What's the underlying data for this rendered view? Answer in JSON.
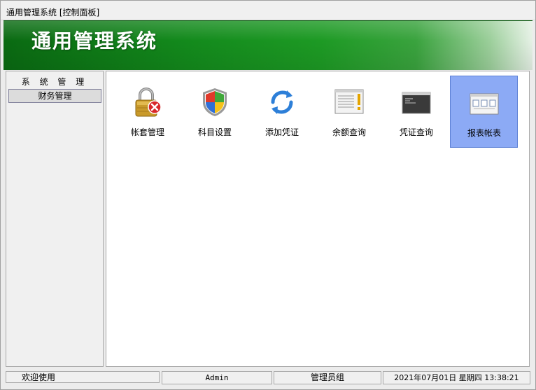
{
  "window": {
    "title": "通用管理系统 [控制面板]"
  },
  "banner": {
    "title": "通用管理系统"
  },
  "sidebar": {
    "category": "系 统 管 理",
    "items": [
      {
        "label": "财务管理",
        "selected": true
      }
    ]
  },
  "tiles": [
    {
      "label": "帐套管理",
      "icon": "padlock-remove-icon",
      "selected": false
    },
    {
      "label": "科目设置",
      "icon": "shield-icon",
      "selected": false
    },
    {
      "label": "添加凭证",
      "icon": "refresh-arrows-icon",
      "selected": false
    },
    {
      "label": "余额查询",
      "icon": "notice-document-icon",
      "selected": false
    },
    {
      "label": "凭证查询",
      "icon": "terminal-window-icon",
      "selected": false
    },
    {
      "label": "报表帐表",
      "icon": "report-window-icon",
      "selected": true
    }
  ],
  "status": {
    "welcome": "欢迎使用",
    "user": "Admin",
    "group": "管理员组",
    "datetime": "2021年07月01日 星期四 13:38:21"
  },
  "colors": {
    "banner_green": "#138a1c",
    "selection_blue": "#8caaf5"
  }
}
